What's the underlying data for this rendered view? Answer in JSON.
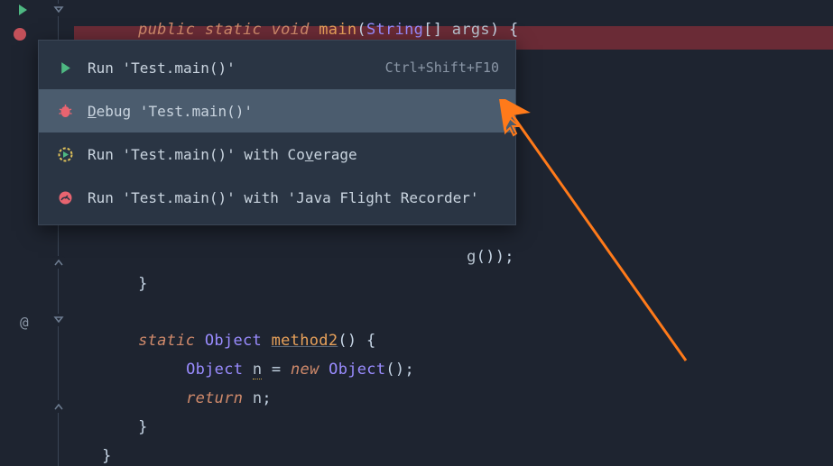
{
  "code": {
    "line1": {
      "modifiers": "public static",
      "void": "void",
      "method": "main",
      "params_open": "(",
      "type": "String",
      "brackets": "[]",
      "arg": "args",
      "params_close": ") {"
    },
    "line_after_menu_brace": "}",
    "method2": {
      "static": "static",
      "return_type": "Object",
      "name": "method2",
      "parens": "() {",
      "body1_type": "Object",
      "body1_var": "n",
      "body1_eq": " = ",
      "body1_new": "new",
      "body1_ctor": "Object",
      "body1_end": "();",
      "return_kw": "return",
      "return_var": "n",
      "return_end": ";",
      "close": "}"
    },
    "outer_close": "}",
    "obscured_line": "g",
    "obscured_end": "());"
  },
  "gutter": {
    "annotation": "@"
  },
  "menu": {
    "items": [
      {
        "label_pre": "Run 'Test.main()'",
        "shortcut": "Ctrl+Shift+F10"
      },
      {
        "label_pre": "",
        "underline": "D",
        "label_post": "ebug 'Test.main()'"
      },
      {
        "label_pre": "Run 'Test.main()' with Co",
        "underline": "v",
        "label_post": "erage"
      },
      {
        "label_pre": "Run 'Test.main()' with 'Java Flight Recorder'"
      }
    ]
  }
}
